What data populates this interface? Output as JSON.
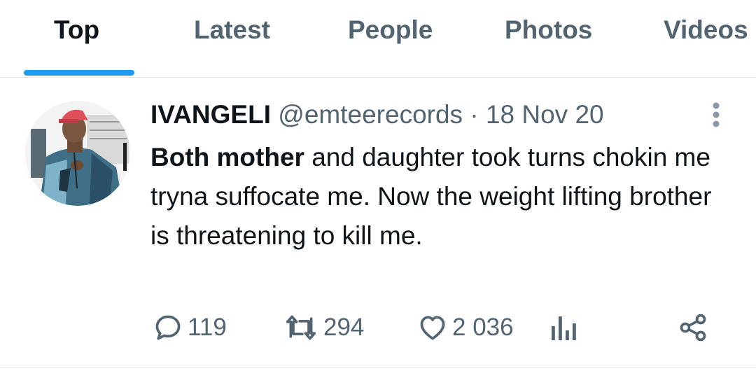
{
  "tabs": [
    {
      "label": "Top",
      "active": true
    },
    {
      "label": "Latest",
      "active": false
    },
    {
      "label": "People",
      "active": false
    },
    {
      "label": "Photos",
      "active": false
    },
    {
      "label": "Videos",
      "active": false
    }
  ],
  "tweet": {
    "display_name": "IVANGELI",
    "handle": "@emteerecords",
    "separator": "·",
    "date": "18 Nov 20",
    "text_bold": "Both mother",
    "text_rest": " and daughter took turns chokin me tryna suffocate me. Now the weight lifting brother is threatening to kill me.",
    "replies": "119",
    "reposts": "294",
    "likes": "2 036",
    "icons": {
      "more": "more-vertical-icon",
      "reply": "reply-icon",
      "repost": "repost-icon",
      "like": "heart-icon",
      "views": "views-icon",
      "share": "share-icon"
    }
  },
  "colors": {
    "accent": "#1d9bf0",
    "text_primary": "#0f1419",
    "text_secondary": "#536471",
    "divider": "#e3e6e9"
  }
}
